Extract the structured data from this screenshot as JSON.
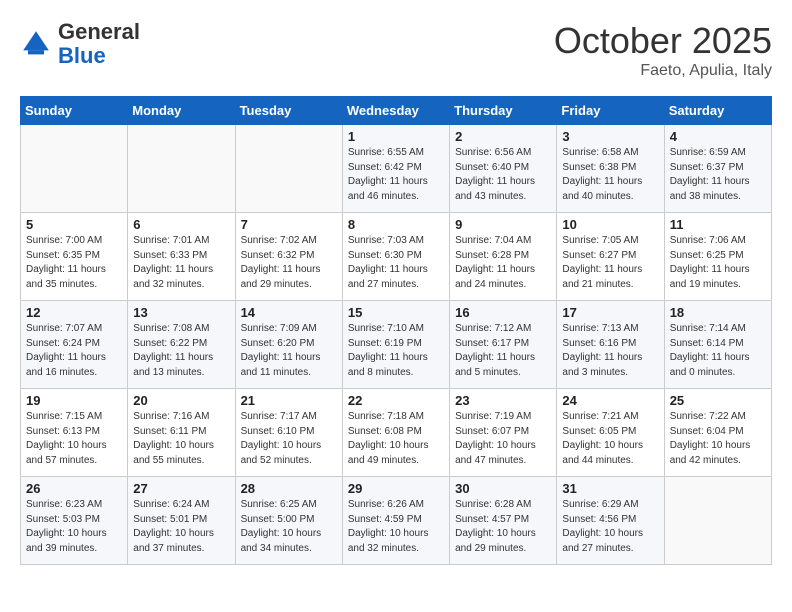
{
  "header": {
    "logo_general": "General",
    "logo_blue": "Blue",
    "month": "October 2025",
    "location": "Faeto, Apulia, Italy"
  },
  "weekdays": [
    "Sunday",
    "Monday",
    "Tuesday",
    "Wednesday",
    "Thursday",
    "Friday",
    "Saturday"
  ],
  "weeks": [
    [
      {
        "day": "",
        "info": ""
      },
      {
        "day": "",
        "info": ""
      },
      {
        "day": "",
        "info": ""
      },
      {
        "day": "1",
        "info": "Sunrise: 6:55 AM\nSunset: 6:42 PM\nDaylight: 11 hours\nand 46 minutes."
      },
      {
        "day": "2",
        "info": "Sunrise: 6:56 AM\nSunset: 6:40 PM\nDaylight: 11 hours\nand 43 minutes."
      },
      {
        "day": "3",
        "info": "Sunrise: 6:58 AM\nSunset: 6:38 PM\nDaylight: 11 hours\nand 40 minutes."
      },
      {
        "day": "4",
        "info": "Sunrise: 6:59 AM\nSunset: 6:37 PM\nDaylight: 11 hours\nand 38 minutes."
      }
    ],
    [
      {
        "day": "5",
        "info": "Sunrise: 7:00 AM\nSunset: 6:35 PM\nDaylight: 11 hours\nand 35 minutes."
      },
      {
        "day": "6",
        "info": "Sunrise: 7:01 AM\nSunset: 6:33 PM\nDaylight: 11 hours\nand 32 minutes."
      },
      {
        "day": "7",
        "info": "Sunrise: 7:02 AM\nSunset: 6:32 PM\nDaylight: 11 hours\nand 29 minutes."
      },
      {
        "day": "8",
        "info": "Sunrise: 7:03 AM\nSunset: 6:30 PM\nDaylight: 11 hours\nand 27 minutes."
      },
      {
        "day": "9",
        "info": "Sunrise: 7:04 AM\nSunset: 6:28 PM\nDaylight: 11 hours\nand 24 minutes."
      },
      {
        "day": "10",
        "info": "Sunrise: 7:05 AM\nSunset: 6:27 PM\nDaylight: 11 hours\nand 21 minutes."
      },
      {
        "day": "11",
        "info": "Sunrise: 7:06 AM\nSunset: 6:25 PM\nDaylight: 11 hours\nand 19 minutes."
      }
    ],
    [
      {
        "day": "12",
        "info": "Sunrise: 7:07 AM\nSunset: 6:24 PM\nDaylight: 11 hours\nand 16 minutes."
      },
      {
        "day": "13",
        "info": "Sunrise: 7:08 AM\nSunset: 6:22 PM\nDaylight: 11 hours\nand 13 minutes."
      },
      {
        "day": "14",
        "info": "Sunrise: 7:09 AM\nSunset: 6:20 PM\nDaylight: 11 hours\nand 11 minutes."
      },
      {
        "day": "15",
        "info": "Sunrise: 7:10 AM\nSunset: 6:19 PM\nDaylight: 11 hours\nand 8 minutes."
      },
      {
        "day": "16",
        "info": "Sunrise: 7:12 AM\nSunset: 6:17 PM\nDaylight: 11 hours\nand 5 minutes."
      },
      {
        "day": "17",
        "info": "Sunrise: 7:13 AM\nSunset: 6:16 PM\nDaylight: 11 hours\nand 3 minutes."
      },
      {
        "day": "18",
        "info": "Sunrise: 7:14 AM\nSunset: 6:14 PM\nDaylight: 11 hours\nand 0 minutes."
      }
    ],
    [
      {
        "day": "19",
        "info": "Sunrise: 7:15 AM\nSunset: 6:13 PM\nDaylight: 10 hours\nand 57 minutes."
      },
      {
        "day": "20",
        "info": "Sunrise: 7:16 AM\nSunset: 6:11 PM\nDaylight: 10 hours\nand 55 minutes."
      },
      {
        "day": "21",
        "info": "Sunrise: 7:17 AM\nSunset: 6:10 PM\nDaylight: 10 hours\nand 52 minutes."
      },
      {
        "day": "22",
        "info": "Sunrise: 7:18 AM\nSunset: 6:08 PM\nDaylight: 10 hours\nand 49 minutes."
      },
      {
        "day": "23",
        "info": "Sunrise: 7:19 AM\nSunset: 6:07 PM\nDaylight: 10 hours\nand 47 minutes."
      },
      {
        "day": "24",
        "info": "Sunrise: 7:21 AM\nSunset: 6:05 PM\nDaylight: 10 hours\nand 44 minutes."
      },
      {
        "day": "25",
        "info": "Sunrise: 7:22 AM\nSunset: 6:04 PM\nDaylight: 10 hours\nand 42 minutes."
      }
    ],
    [
      {
        "day": "26",
        "info": "Sunrise: 6:23 AM\nSunset: 5:03 PM\nDaylight: 10 hours\nand 39 minutes."
      },
      {
        "day": "27",
        "info": "Sunrise: 6:24 AM\nSunset: 5:01 PM\nDaylight: 10 hours\nand 37 minutes."
      },
      {
        "day": "28",
        "info": "Sunrise: 6:25 AM\nSunset: 5:00 PM\nDaylight: 10 hours\nand 34 minutes."
      },
      {
        "day": "29",
        "info": "Sunrise: 6:26 AM\nSunset: 4:59 PM\nDaylight: 10 hours\nand 32 minutes."
      },
      {
        "day": "30",
        "info": "Sunrise: 6:28 AM\nSunset: 4:57 PM\nDaylight: 10 hours\nand 29 minutes."
      },
      {
        "day": "31",
        "info": "Sunrise: 6:29 AM\nSunset: 4:56 PM\nDaylight: 10 hours\nand 27 minutes."
      },
      {
        "day": "",
        "info": ""
      }
    ]
  ]
}
